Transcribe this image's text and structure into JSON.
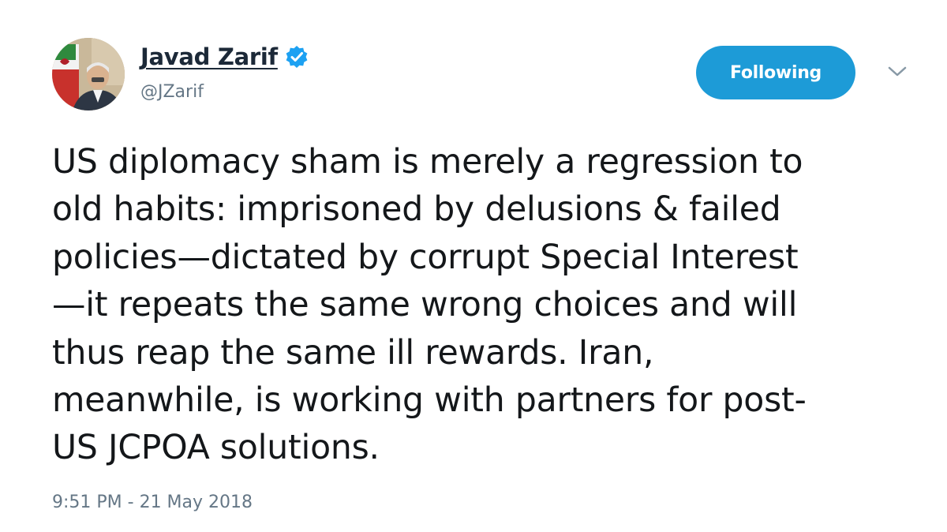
{
  "author": {
    "display_name": "Javad Zarif",
    "handle": "@JZarif",
    "verified": true,
    "avatar_icon": "profile-photo"
  },
  "actions": {
    "follow_label": "Following",
    "menu_icon": "chevron-down-icon"
  },
  "tweet": {
    "lines": [
      "US diplomacy sham is merely a regression to",
      "old habits: imprisoned by delusions & failed",
      "policies—dictated by corrupt Special Interest",
      "—it repeats the same wrong choices and will",
      "thus reap the same ill rewards. Iran,",
      "meanwhile, is working with partners for post-",
      "US JCPOA solutions."
    ],
    "timestamp": "9:51 PM - 21 May 2018"
  },
  "colors": {
    "accent": "#1d9bd7",
    "secondary_text": "#657786",
    "primary_text": "#14171a"
  }
}
